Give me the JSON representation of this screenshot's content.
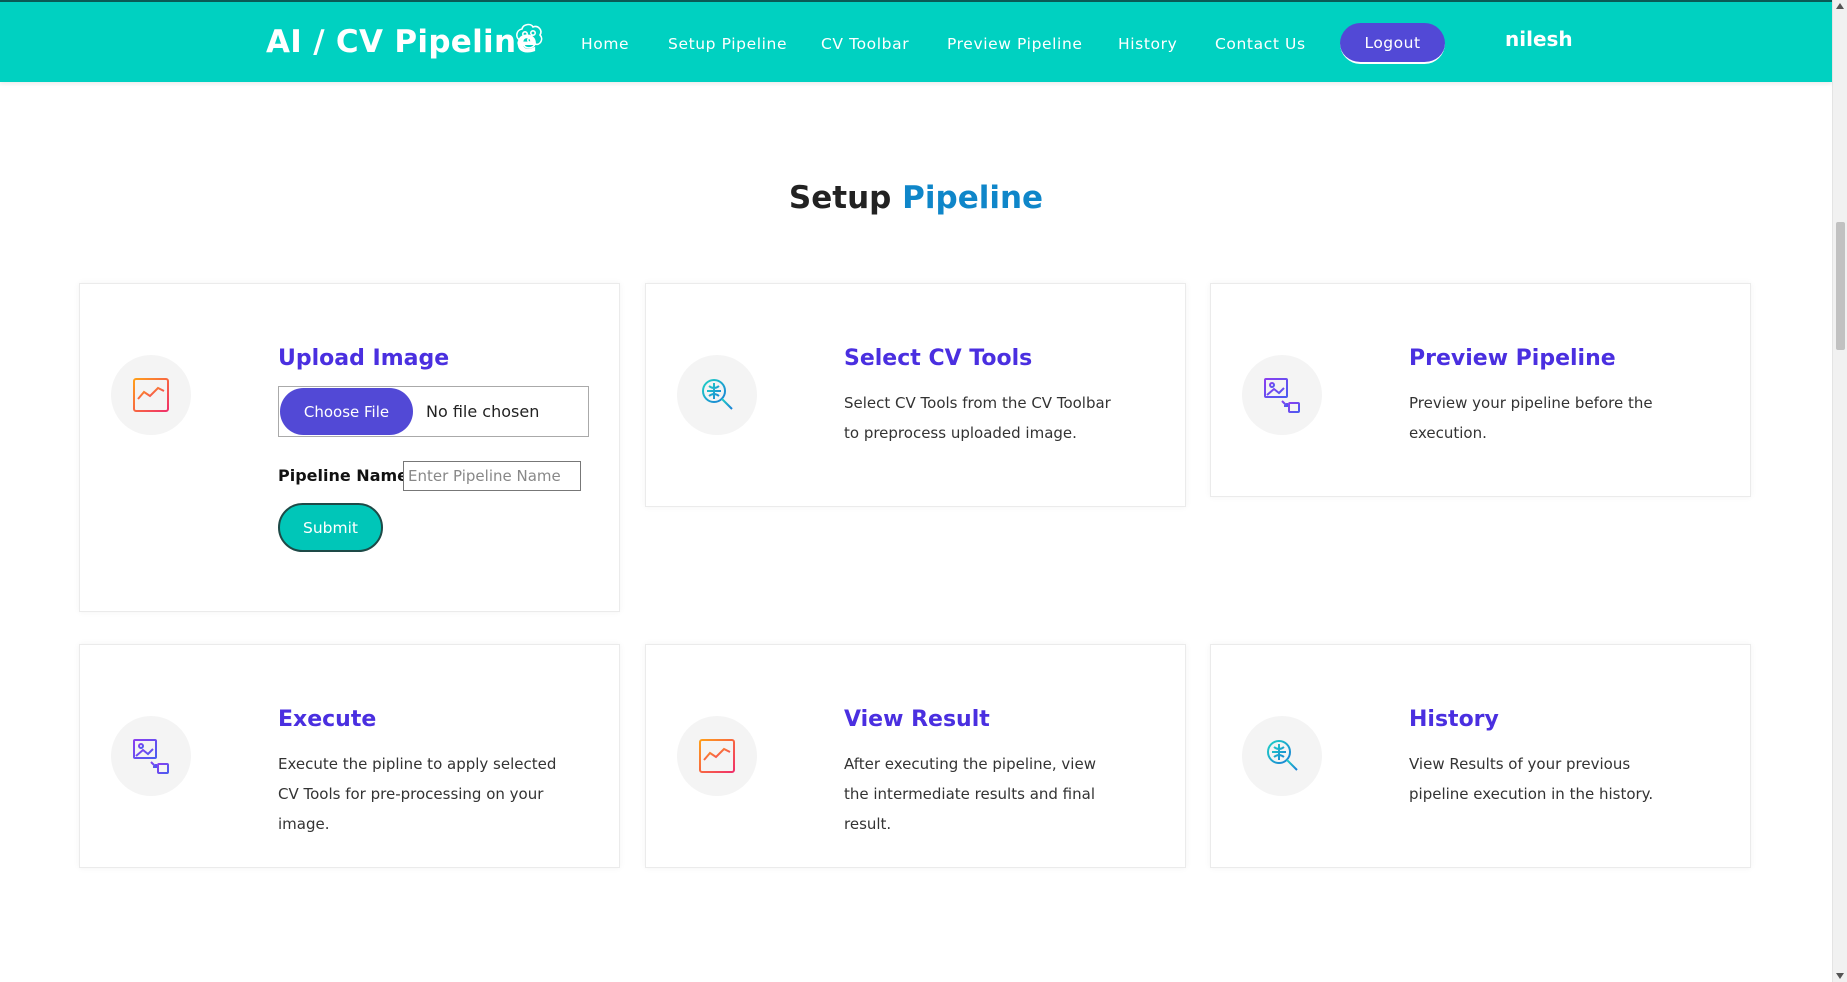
{
  "navbar": {
    "brand": "AI / CV Pipeline",
    "brand_icon": "brain-icon",
    "links": [
      "Home",
      "Setup Pipeline",
      "CV Toolbar",
      "Preview Pipeline",
      "History",
      "Contact Us"
    ],
    "logout_label": "Logout",
    "username": "nilesh"
  },
  "section": {
    "title_main": "Setup",
    "title_accent": "Pipeline"
  },
  "upload_card": {
    "title": "Upload Image",
    "icon": "chart-board-icon",
    "choose_file_label": "Choose File",
    "file_status": "No file chosen",
    "pipeline_name_label": "Pipeline Name:",
    "pipeline_name_placeholder": "Enter Pipeline Name",
    "pipeline_name_value": "",
    "submit_label": "Submit"
  },
  "cards": [
    {
      "title": "Select CV Tools",
      "icon": "search-globe-icon",
      "desc": "Select CV Tools from the CV Toolbar to preprocess uploaded image."
    },
    {
      "title": "Preview Pipeline",
      "icon": "image-preview-icon",
      "desc": "Preview your pipeline before the execution."
    },
    {
      "title": "Execute",
      "icon": "image-preview-icon",
      "desc": "Execute the pipline to apply selected CV Tools for pre-processing on your image."
    },
    {
      "title": "View Result",
      "icon": "chart-board-icon",
      "desc": "After executing the pipeline, view the intermediate results and final result."
    },
    {
      "title": "History",
      "icon": "search-globe-icon",
      "desc": "View Results of your previous pipeline execution in the history."
    }
  ],
  "colors": {
    "navbar_bg": "#00d1c1",
    "accent_purple": "#5249d6",
    "title_purple": "#4a2fe0",
    "title_blue": "#0f86c9",
    "submit_teal": "#00c6b8"
  }
}
